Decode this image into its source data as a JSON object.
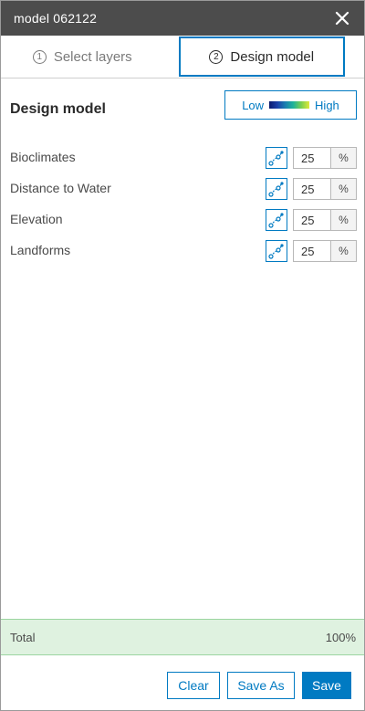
{
  "window": {
    "title": "model 062122",
    "close_icon": "close-icon"
  },
  "tabs": [
    {
      "number": "1",
      "label": "Select layers",
      "active": false
    },
    {
      "number": "2",
      "label": "Design model",
      "active": true
    }
  ],
  "heading": "Design model",
  "legend": {
    "low_label": "Low",
    "high_label": "High",
    "ramp_colors": [
      "#0b1a6e",
      "#1b3fa8",
      "#1a7fb0",
      "#1fb39a",
      "#7bd04f",
      "#dfe93a"
    ]
  },
  "layers": [
    {
      "label": "Bioclimates",
      "weight": "25",
      "unit": "%",
      "config_icon": "configure-transformation-icon"
    },
    {
      "label": "Distance to Water",
      "weight": "25",
      "unit": "%",
      "config_icon": "configure-transformation-icon"
    },
    {
      "label": "Elevation",
      "weight": "25",
      "unit": "%",
      "config_icon": "configure-transformation-icon"
    },
    {
      "label": "Landforms",
      "weight": "25",
      "unit": "%",
      "config_icon": "configure-transformation-icon"
    }
  ],
  "total": {
    "label": "Total",
    "value": "100%"
  },
  "footer": {
    "clear_label": "Clear",
    "save_as_label": "Save As",
    "save_label": "Save"
  },
  "colors": {
    "accent": "#007ac2",
    "titlebar": "#4c4c4c",
    "total_bg": "#dff2e0"
  }
}
